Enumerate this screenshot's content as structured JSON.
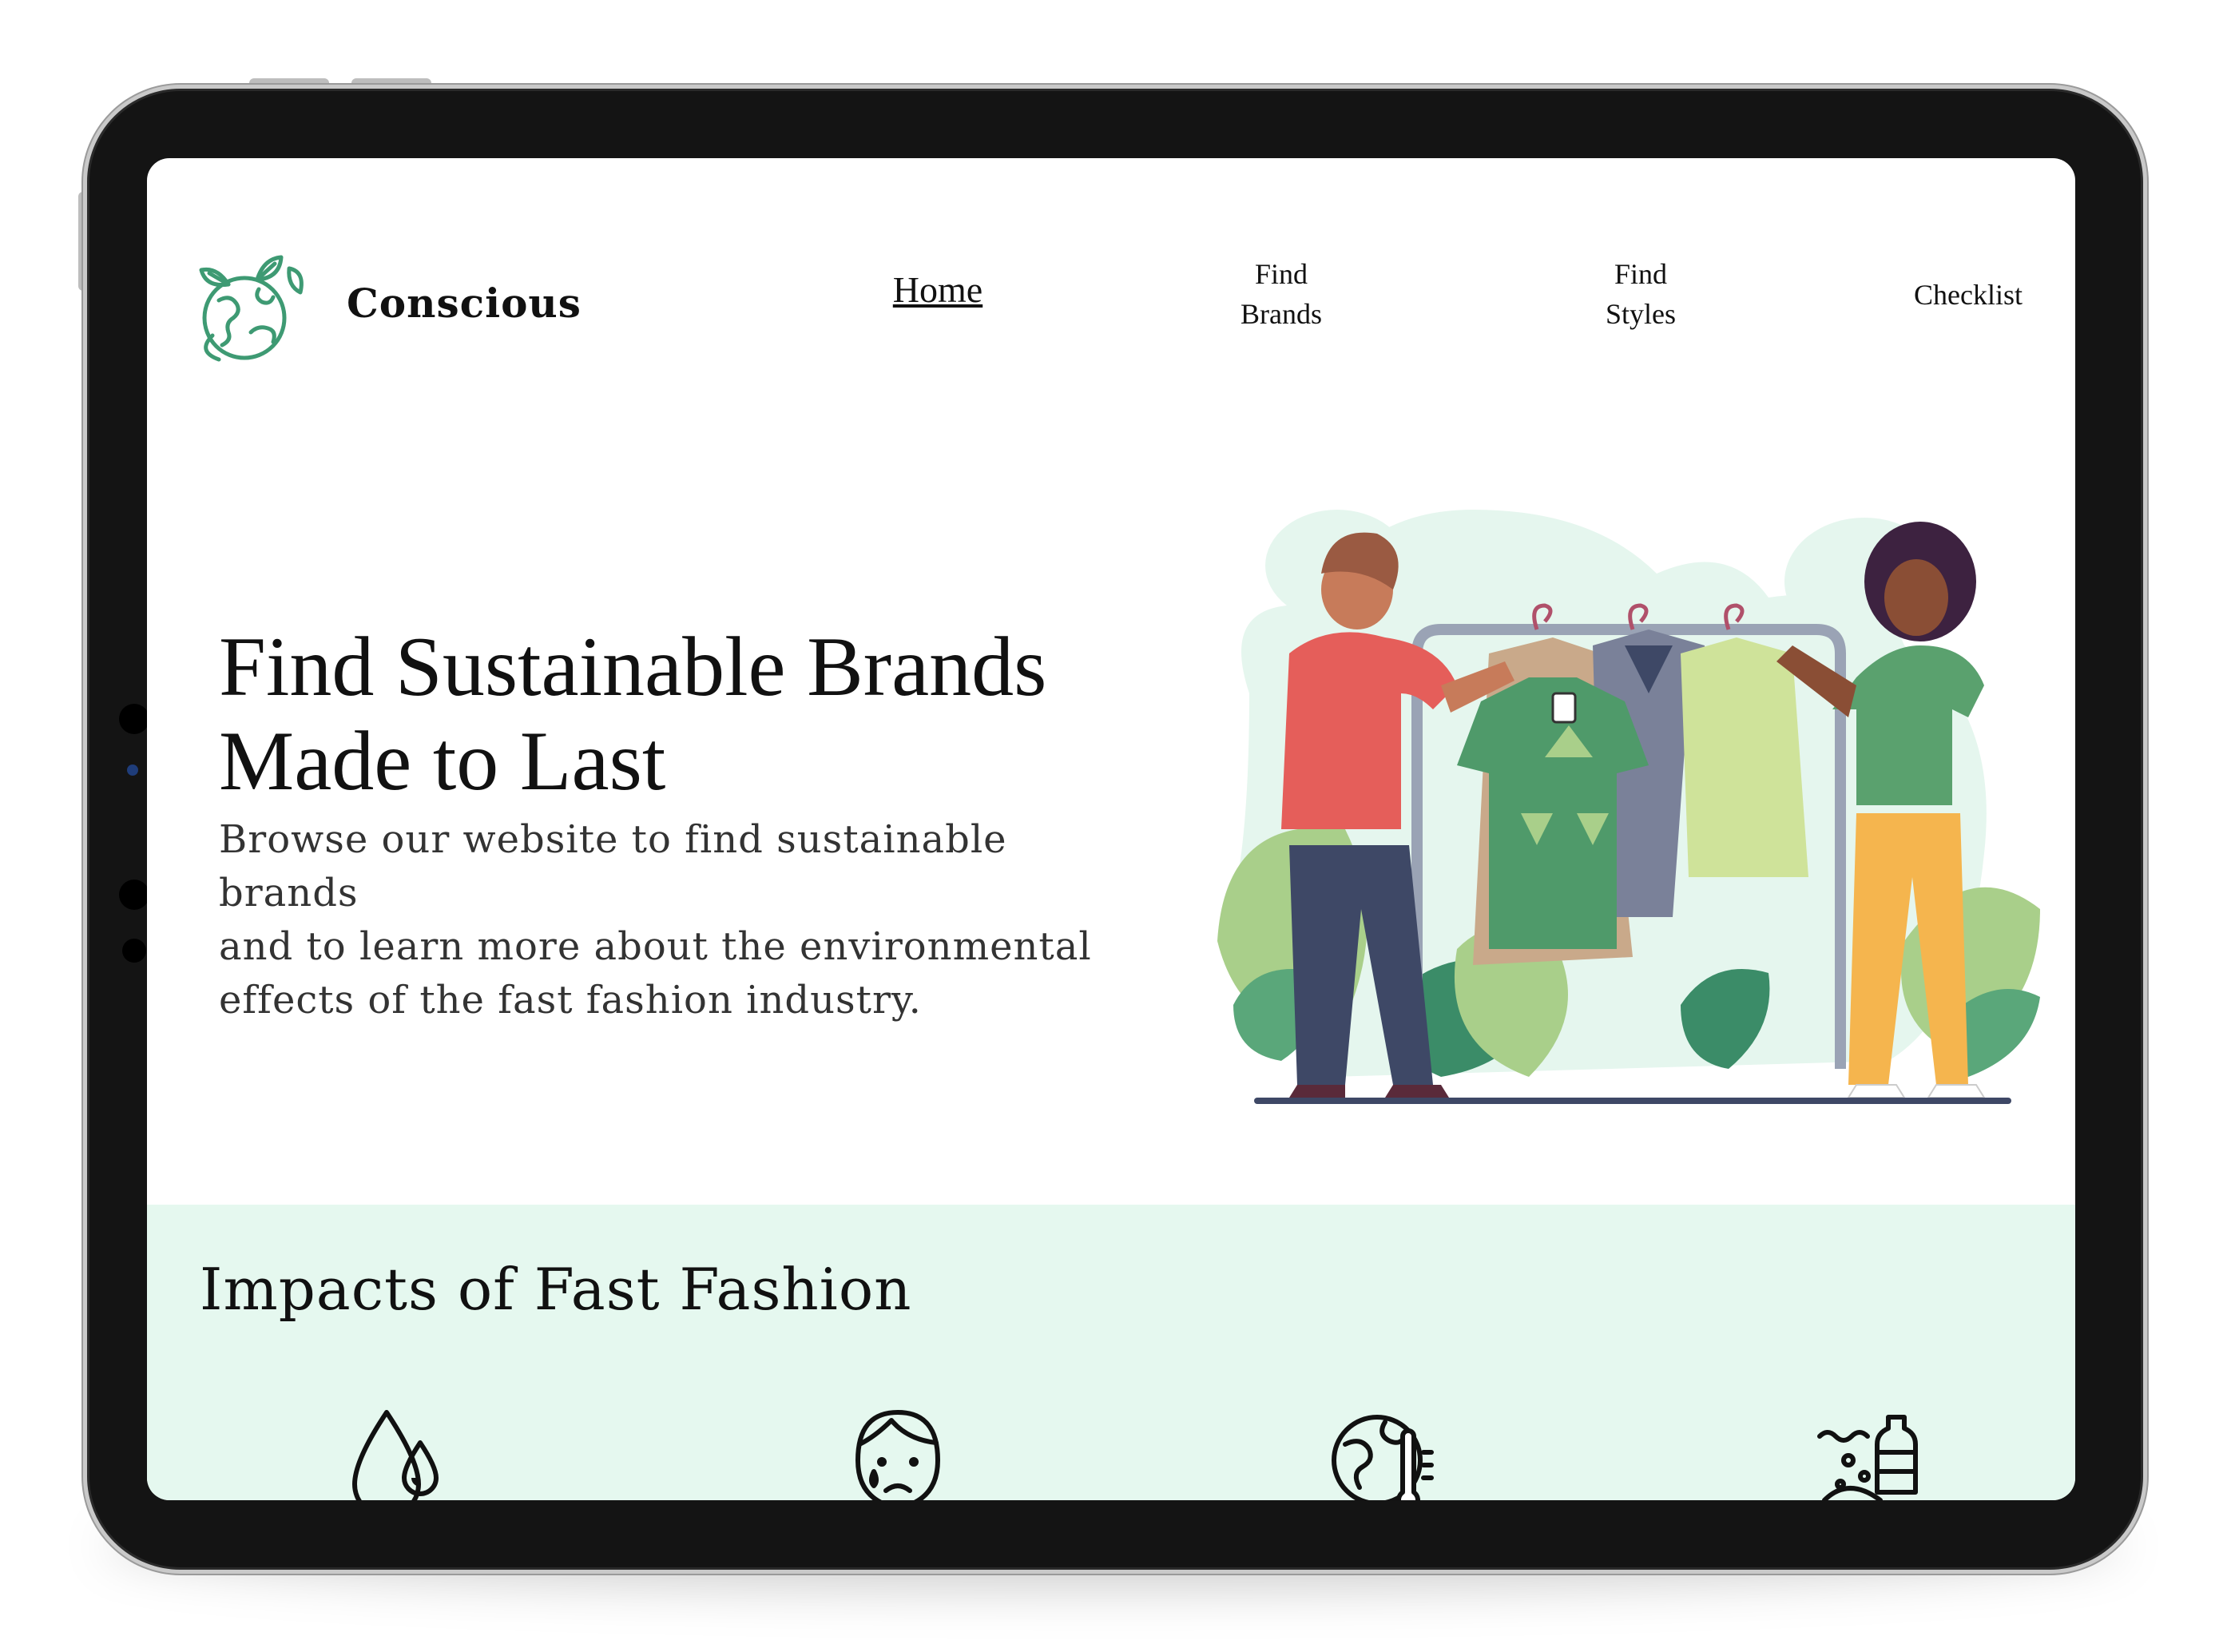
{
  "header": {
    "brand": "Conscious",
    "logo_icon": "earth-leaves-icon",
    "nav": {
      "home": "Home",
      "find_brands_line1": "Find",
      "find_brands_line2": "Brands",
      "find_styles_line1": "Find",
      "find_styles_line2": "Styles",
      "checklist": "Checklist"
    }
  },
  "hero": {
    "title_line1": "Find Sustainable Brands",
    "title_line2": "Made to Last",
    "text_line1": "Browse our website to find sustainable brands",
    "text_line2": "and to learn more about the environmental",
    "text_line3": "effects of the fast fashion industry.",
    "illustration": "clothing-rack-illustration"
  },
  "impacts": {
    "title": "Impacts of Fast Fashion",
    "icons": [
      "water-drops-icon",
      "sad-face-icon",
      "globe-thermometer-icon",
      "ocean-pollution-icon"
    ]
  },
  "colors": {
    "accent_green": "#3e9a73",
    "section_bg": "#e5f8ef",
    "device_frame": "#141414"
  }
}
